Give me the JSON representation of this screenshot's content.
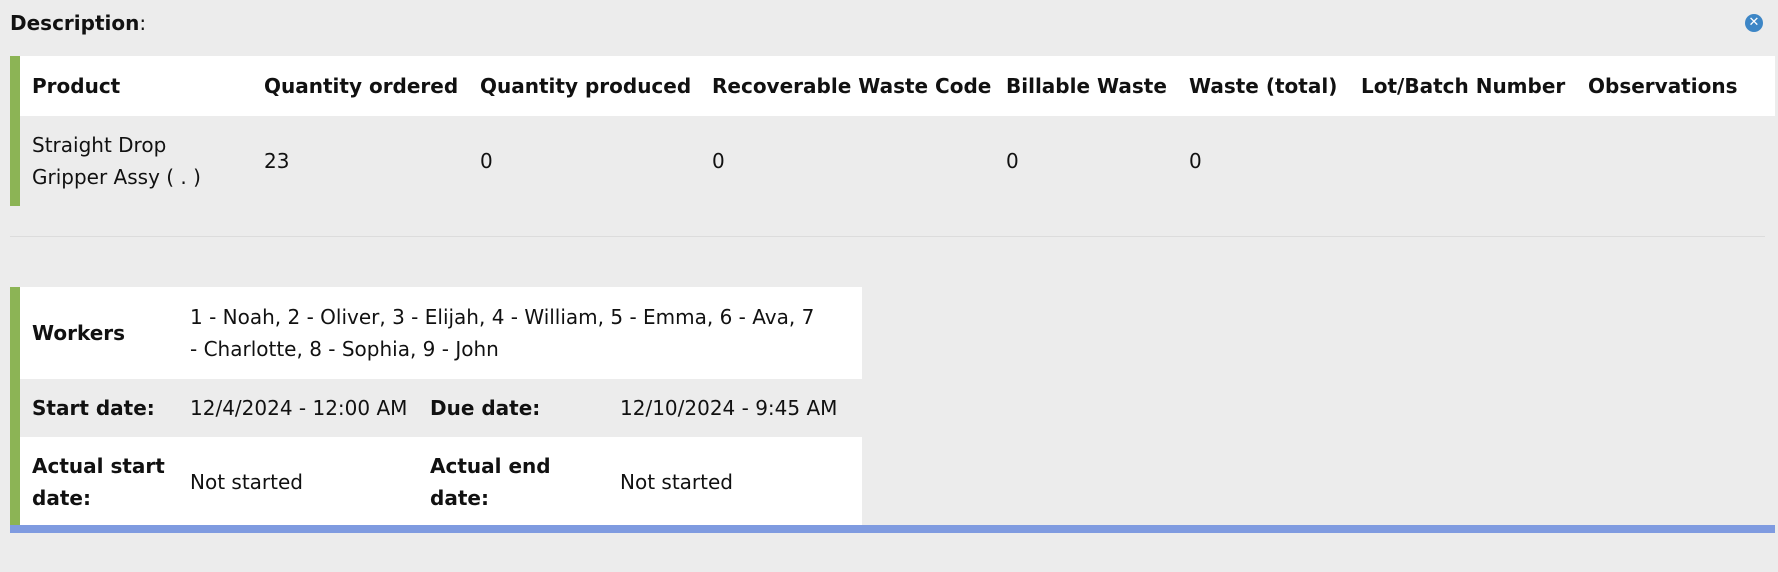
{
  "header": {
    "title": "Description",
    "title_suffix": ":",
    "close_icon": "close-icon"
  },
  "product_table": {
    "columns": [
      "Product",
      "Quantity ordered",
      "Quantity produced",
      "Recoverable Waste Code",
      "Billable Waste",
      "Waste (total)",
      "Lot/Batch Number",
      "Observations"
    ],
    "rows": [
      [
        "Straight Drop Gripper Assy ( . )",
        "23",
        "0",
        "0",
        "0",
        "0",
        "",
        ""
      ]
    ]
  },
  "info": {
    "workers_label": "Workers",
    "workers_value": "1 - Noah, 2 - Oliver, 3 - Elijah, 4 - William, 5 - Emma, 6 - Ava, 7 - Charlotte, 8 - Sophia, 9 - John",
    "start_date_label": "Start date:",
    "start_date_value": "12/4/2024 - 12:00 AM",
    "due_date_label": "Due date:",
    "due_date_value": "12/10/2024 - 9:45 AM",
    "actual_start_label": "Actual start date:",
    "actual_start_value": "Not started",
    "actual_end_label": "Actual end date:",
    "actual_end_value": "Not started"
  },
  "colors": {
    "accent_green": "#8cb455",
    "accent_blue": "#7f9be0",
    "close_blue": "#3d86c6"
  }
}
